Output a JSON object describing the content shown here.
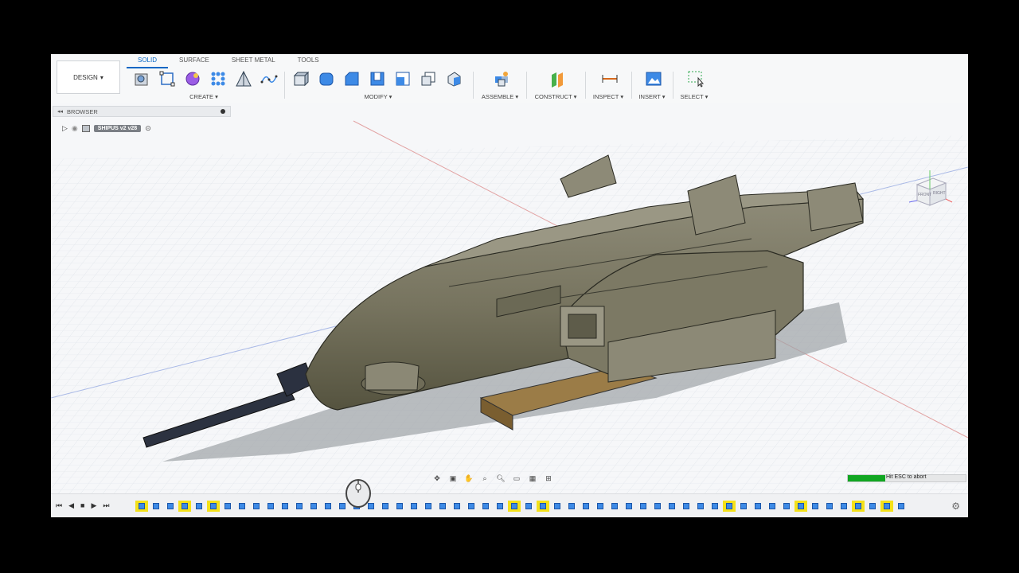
{
  "workspace": {
    "label": "DESIGN"
  },
  "tabs": [
    "SOLID",
    "SURFACE",
    "SHEET METAL",
    "TOOLS"
  ],
  "groups": {
    "create": "CREATE",
    "modify": "MODIFY",
    "assemble": "ASSEMBLE",
    "construct": "CONSTRUCT",
    "inspect": "INSPECT",
    "insert": "INSERT",
    "select": "SELECT"
  },
  "browser": {
    "title": "BROWSER",
    "document": "SHIPUS v2 v28"
  },
  "viewcube": {
    "front": "FRONT",
    "right": "RIGHT"
  },
  "progress": {
    "text": "Hit ESC to abort",
    "fraction": 0.32
  },
  "colors": {
    "accent": "#0a67c4",
    "progress": "#11a622",
    "highlight": "#f4e11a",
    "model": "#7d7a66"
  }
}
